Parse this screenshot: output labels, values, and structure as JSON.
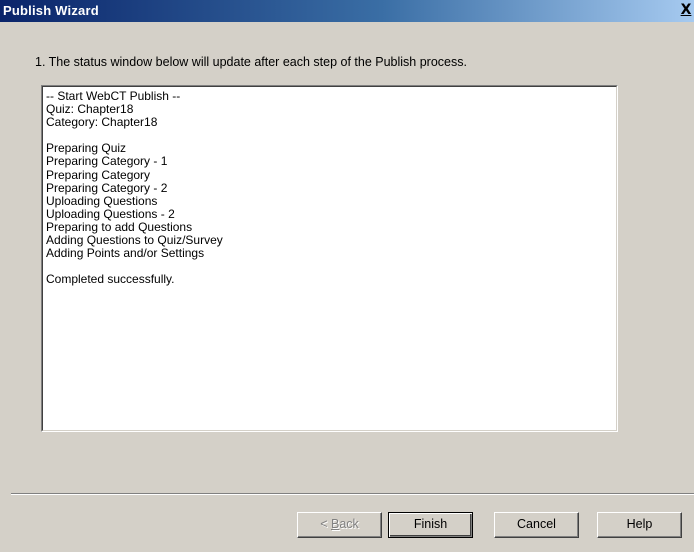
{
  "window": {
    "title": "Publish Wizard",
    "close_label": "X"
  },
  "instruction": "1.  The status window below will update after each step of the Publish process.",
  "status_lines": [
    "-- Start WebCT Publish --",
    "Quiz: Chapter18",
    "Category: Chapter18",
    "",
    "Preparing Quiz",
    "Preparing Category - 1",
    "Preparing Category",
    "Preparing Category - 2",
    "Uploading Questions",
    "Uploading Questions - 2",
    "Preparing to add Questions",
    "Adding Questions to Quiz/Survey",
    "Adding Points and/or Settings",
    "",
    "Completed successfully."
  ],
  "buttons": {
    "back_prefix": "< ",
    "back_mnemonic": "B",
    "back_rest": "ack",
    "back_enabled": false,
    "finish": "Finish",
    "cancel": "Cancel",
    "help": "Help"
  },
  "colors": {
    "titlebar_start": "#0a246a",
    "titlebar_end": "#a6caf0",
    "dialog_background": "#d4d0c8",
    "status_background": "#ffffff",
    "disabled_text": "#808080"
  }
}
